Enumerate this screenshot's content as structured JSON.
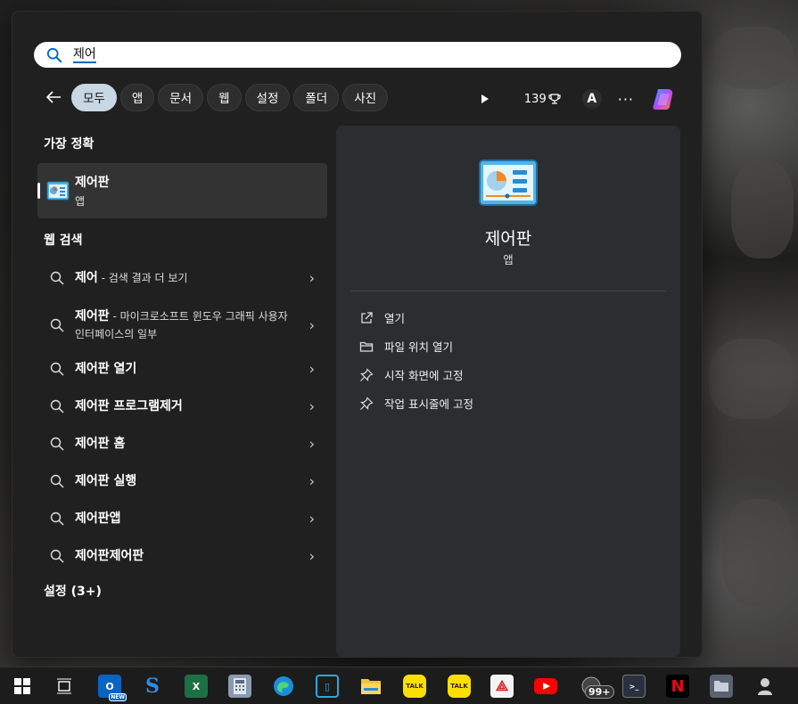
{
  "search": {
    "query": "제어"
  },
  "filters": [
    "모두",
    "앱",
    "문서",
    "웹",
    "설정",
    "폴더",
    "사진"
  ],
  "toolbar": {
    "points": "139",
    "account_initial": "A",
    "more": "···"
  },
  "best_match": {
    "title": "가장 정확",
    "name": "제어판",
    "type": "앱"
  },
  "web_search": {
    "title": "웹 검색",
    "items": [
      {
        "bold": "제어",
        "rest": " - 검색 결과 더 보기"
      },
      {
        "bold": "제어판",
        "rest": " - 마이크로소프트 윈도우 그래픽 사용자 인터페이스의 일부"
      },
      {
        "bold": "제어판 열기",
        "rest": ""
      },
      {
        "bold": "제어판 프로그램제거",
        "rest": ""
      },
      {
        "bold": "제어판 홈",
        "rest": ""
      },
      {
        "bold": "제어판 실행",
        "rest": ""
      },
      {
        "bold": "제어판앱",
        "rest": ""
      },
      {
        "bold": "제어판제어판",
        "rest": ""
      }
    ]
  },
  "settings_section": "설정 (3+)",
  "detail": {
    "name": "제어판",
    "type": "앱",
    "actions": [
      "열기",
      "파일 위치 열기",
      "시작 화면에 고정",
      "작업 표시줄에 고정"
    ]
  },
  "taskbar": {
    "badge": "99+",
    "outlook_badge": "NEW"
  },
  "colors": {
    "accent": "#0067c0",
    "chip_active": "#c9d6e3",
    "panel": "#202020",
    "detail": "#2b2d30"
  }
}
